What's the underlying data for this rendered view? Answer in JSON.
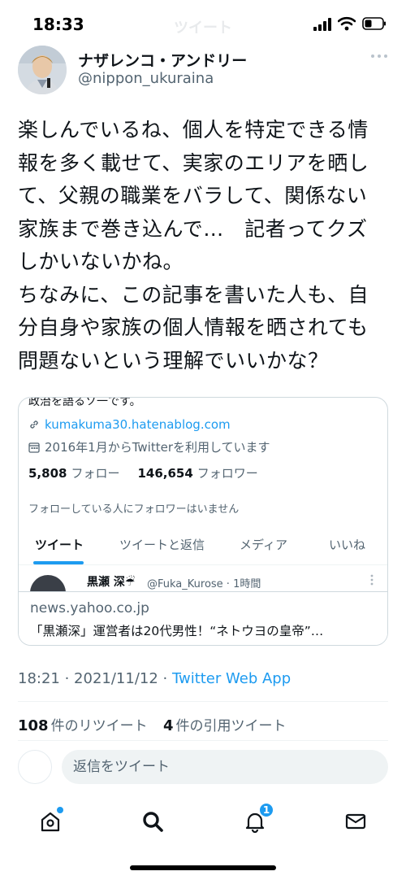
{
  "status_bar": {
    "time": "18:33",
    "ghost_title": "ツイート",
    "icons": [
      "signal-icon",
      "wifi-icon",
      "battery-icon"
    ]
  },
  "tweet": {
    "display_name": "ナザレンコ・アンドリー",
    "username": "@nippon_ukuraina",
    "text": "楽しんでいるね、個人を特定できる情\n報を多く載せて、実家のエリアを晒し\nて、父親の職業をバラして、関係ない\n家族まで巻き込んで…　記者ってクズ\nしかいないかね。\nちなみに、この記事を書いた人も、自\n分自身や家族の個人情報を晒されても\n問題ないという理解でいいかな？",
    "meta_time": "18:21 · 2021/11/12 · ",
    "meta_source": "Twitter Web App",
    "retweet_count": "108",
    "retweet_label": "件のリツイート",
    "quote_count": "4",
    "quote_label": "件の引用ツイート"
  },
  "card": {
    "cut_line": "政治を語るソ一です。",
    "link": "kumakuma30.hatenablog.com",
    "joined": "2016年1月からTwitterを利用しています",
    "following_count": "5,808",
    "following_label": "フォロー",
    "followers_count": "146,654",
    "followers_label": "フォロワー",
    "follow_note": "フォローしている人にフォロワーはいません",
    "tabs": [
      "ツイート",
      "ツイートと返信",
      "メディア",
      "いいね"
    ],
    "row_name": "黒瀬 深☔",
    "row_handle": "@Fuka_Kurose · 1時間",
    "domain": "news.yahoo.co.jp",
    "title": "「黒瀬深」運営者は20代男性！“ネトウヨの皇帝”…"
  },
  "reply": {
    "placeholder": "返信をツイート"
  },
  "nav": {
    "notification_count": "1",
    "icons": [
      "home-icon",
      "search-icon",
      "bell-icon",
      "mail-icon"
    ]
  },
  "colors": {
    "accent": "#1d9bf0",
    "text": "#0f1419",
    "secondary": "#536471"
  }
}
